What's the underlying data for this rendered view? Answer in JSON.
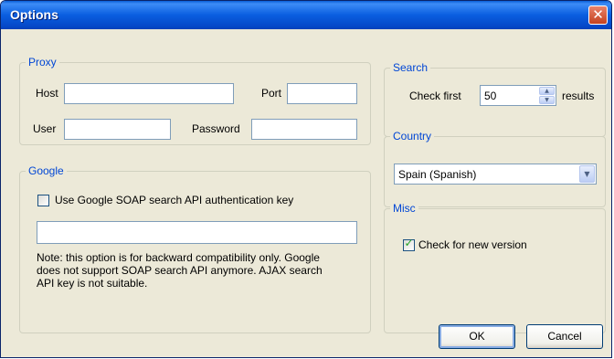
{
  "window": {
    "title": "Options",
    "close_label": "✕"
  },
  "proxy": {
    "legend": "Proxy",
    "host_label": "Host",
    "host_value": "",
    "port_label": "Port",
    "port_value": "",
    "user_label": "User",
    "user_value": "",
    "password_label": "Password",
    "password_value": ""
  },
  "google": {
    "legend": "Google",
    "checkbox_label": "Use Google SOAP search API authentication key",
    "checked": false,
    "key_value": "",
    "note_lines": [
      "Note: this option is for backward compatibility only. Google",
      "does not support SOAP search API anymore. AJAX search",
      "API key is not suitable."
    ]
  },
  "search": {
    "legend": "Search",
    "check_first_label": "Check first",
    "value": "50",
    "results_label": "results"
  },
  "country": {
    "legend": "Country",
    "selected": "Spain (Spanish)"
  },
  "misc": {
    "legend": "Misc",
    "check_version_label": "Check for new version",
    "check_mark": "✓"
  },
  "buttons": {
    "ok": "OK",
    "cancel": "Cancel"
  },
  "colors": {
    "titlebar": "#0a5ee0",
    "legend_text": "#0046d5",
    "dialog_bg": "#ece9d8",
    "close_button": "#c4421f"
  }
}
